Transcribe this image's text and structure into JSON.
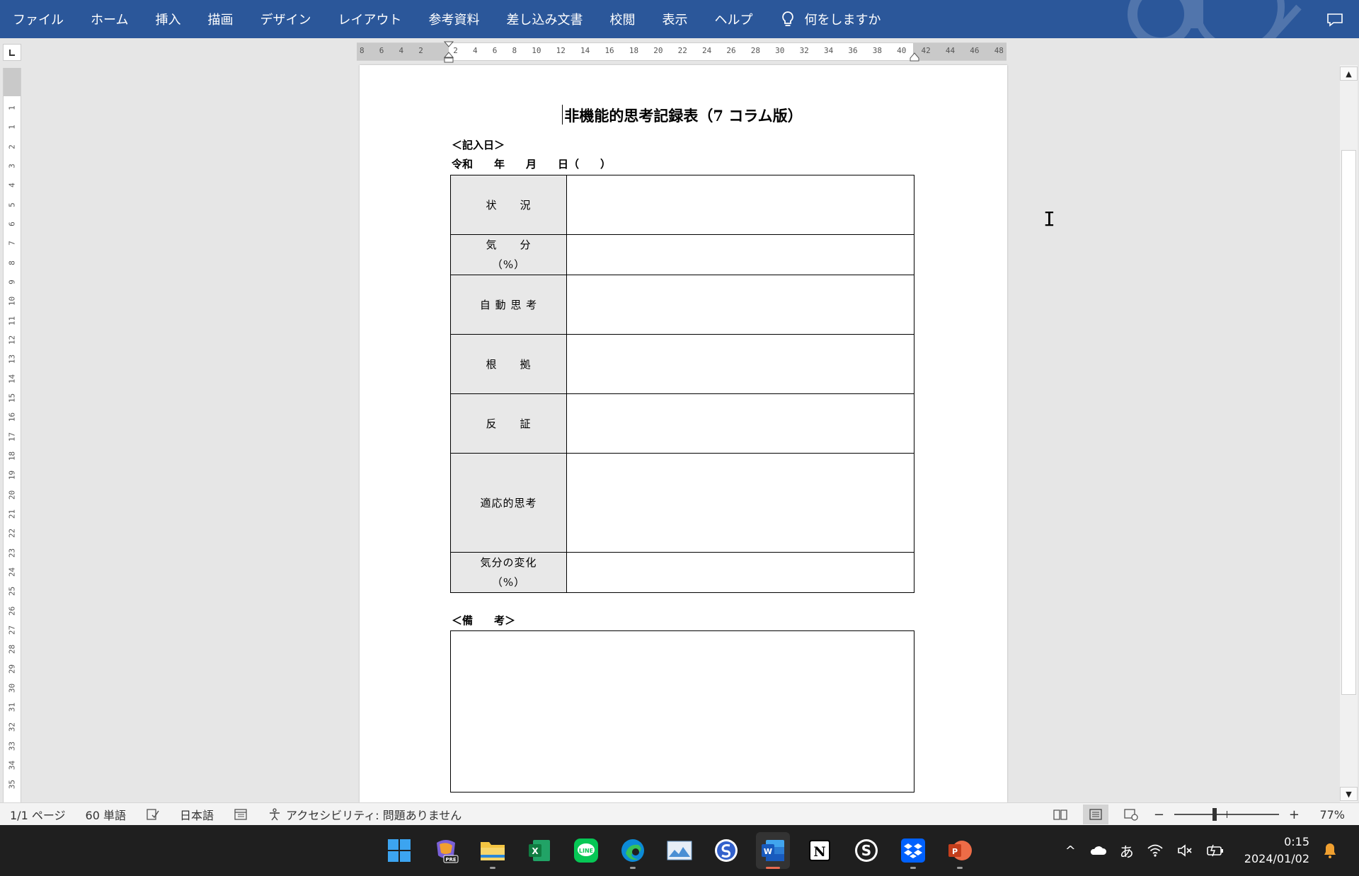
{
  "ribbon": {
    "tabs": [
      "ファイル",
      "ホーム",
      "挿入",
      "描画",
      "デザイン",
      "レイアウト",
      "参考資料",
      "差し込み文書",
      "校閲",
      "表示",
      "ヘルプ"
    ],
    "tell_me": "何をしますか",
    "accent": "#2b579a"
  },
  "ruler": {
    "h_numbers": [
      "8",
      "6",
      "4",
      "2",
      "",
      "2",
      "4",
      "6",
      "8",
      "10",
      "12",
      "14",
      "16",
      "18",
      "20",
      "22",
      "24",
      "26",
      "28",
      "30",
      "32",
      "34",
      "36",
      "38",
      "40",
      "42",
      "44",
      "46",
      "48"
    ],
    "v_numbers": [
      "1",
      "1",
      "2",
      "3",
      "4",
      "5",
      "6",
      "7",
      "8",
      "9",
      "10",
      "11",
      "12",
      "13",
      "14",
      "15",
      "16",
      "17",
      "18",
      "19",
      "20",
      "21",
      "22",
      "23",
      "24",
      "25",
      "26",
      "27",
      "28",
      "29",
      "30",
      "31",
      "32",
      "33",
      "34",
      "35"
    ]
  },
  "document": {
    "title": "非機能的思考記録表（7 コラム版）",
    "date_heading": "＜記入日＞",
    "date_line": "令和　　年　　月　　日（　　）",
    "rows": [
      {
        "label": "状　　況"
      },
      {
        "label": "気　　分\n（%）"
      },
      {
        "label": "自 動 思 考"
      },
      {
        "label": "根　　拠"
      },
      {
        "label": "反　　証"
      },
      {
        "label": "適応的思考"
      },
      {
        "label": "気分の変化\n（%）"
      }
    ],
    "notes_heading": "＜備　　考＞"
  },
  "status": {
    "page": "1/1 ページ",
    "words": "60 単語",
    "language": "日本語",
    "accessibility": "アクセシビリティ: 問題ありません",
    "zoom": "77%"
  },
  "taskbar": {
    "apps": [
      "windows-start",
      "copilot-pre",
      "file-explorer",
      "excel",
      "line",
      "edge",
      "photos",
      "simplenote",
      "word",
      "notion",
      "s-app",
      "dropbox",
      "powerpoint"
    ],
    "ime": "あ",
    "time": "0:15",
    "date": "2024/01/02"
  }
}
